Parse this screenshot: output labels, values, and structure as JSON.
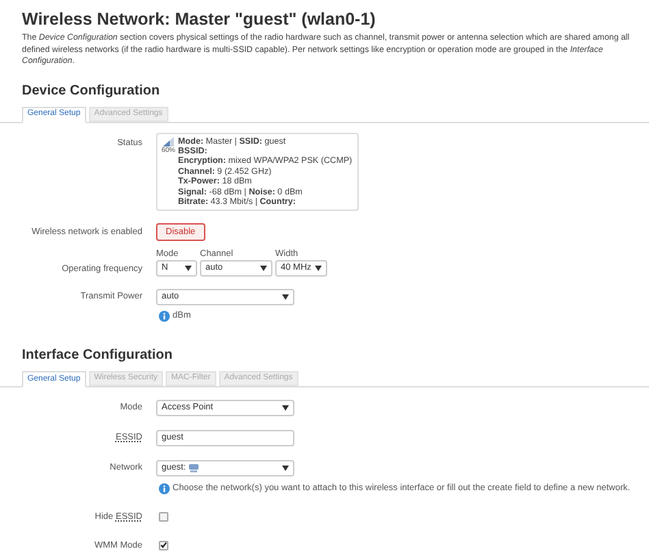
{
  "title": "Wireless Network: Master \"guest\" (wlan0-1)",
  "intro": "The *Device Configuration* section covers physical settings of the radio hardware such as channel, transmit power or antenna selection which are shared among all defined wireless networks (if the radio hardware is multi-SSID capable). Per network settings like encryption or operation mode are grouped in the *Interface Configuration*.",
  "device_configuration": {
    "heading": "Device Configuration",
    "tabs": [
      {
        "label": "General Setup",
        "selected": true
      },
      {
        "label": "Advanced Settings",
        "selected": false
      }
    ],
    "fields": [
      {
        "kind": "status",
        "label": "Status",
        "percent": "60%",
        "lines": [
          "**Mode:** Master | **SSID:** guest",
          "**BSSID:**",
          "**Encryption:** mixed WPA/WPA2 PSK (CCMP)",
          "**Channel:** 9 (2.452 GHz)",
          "**Tx-Power:** 18 dBm",
          "**Signal:** -68 dBm | **Noise:** 0 dBm",
          "**Bitrate:** 43.3 Mbit/s | **Country:**"
        ]
      },
      {
        "kind": "button",
        "label": "Wireless network is enabled",
        "button": "Disable"
      },
      {
        "kind": "frequency",
        "label": "Operating frequency",
        "selects": [
          {
            "caption": "Mode",
            "value": "N"
          },
          {
            "caption": "Channel",
            "value": "auto"
          },
          {
            "caption": "Width",
            "value": "40 MHz"
          }
        ]
      },
      {
        "kind": "select",
        "label": "Transmit Power",
        "value": "auto",
        "hint": "dBm"
      }
    ]
  },
  "interface_configuration": {
    "heading": "Interface Configuration",
    "tabs": [
      {
        "label": "General Setup",
        "selected": true
      },
      {
        "label": "Wireless Security",
        "selected": false
      },
      {
        "label": "MAC-Filter",
        "selected": false
      },
      {
        "label": "Advanced Settings",
        "selected": false
      }
    ],
    "fields": [
      {
        "kind": "select",
        "label": "Mode",
        "value": "Access Point"
      },
      {
        "kind": "text",
        "label": "ESSID",
        "abbr": true,
        "value": "guest"
      },
      {
        "kind": "network",
        "label": "Network",
        "value": "guest:",
        "hint": "Choose the network(s) you want to attach to this wireless interface or fill out the create field to define a new network."
      },
      {
        "kind": "checkbox",
        "label": "Hide",
        "abbr_label": "ESSID",
        "checked": false
      },
      {
        "kind": "checkbox",
        "label": "WMM Mode",
        "checked": true
      }
    ]
  }
}
